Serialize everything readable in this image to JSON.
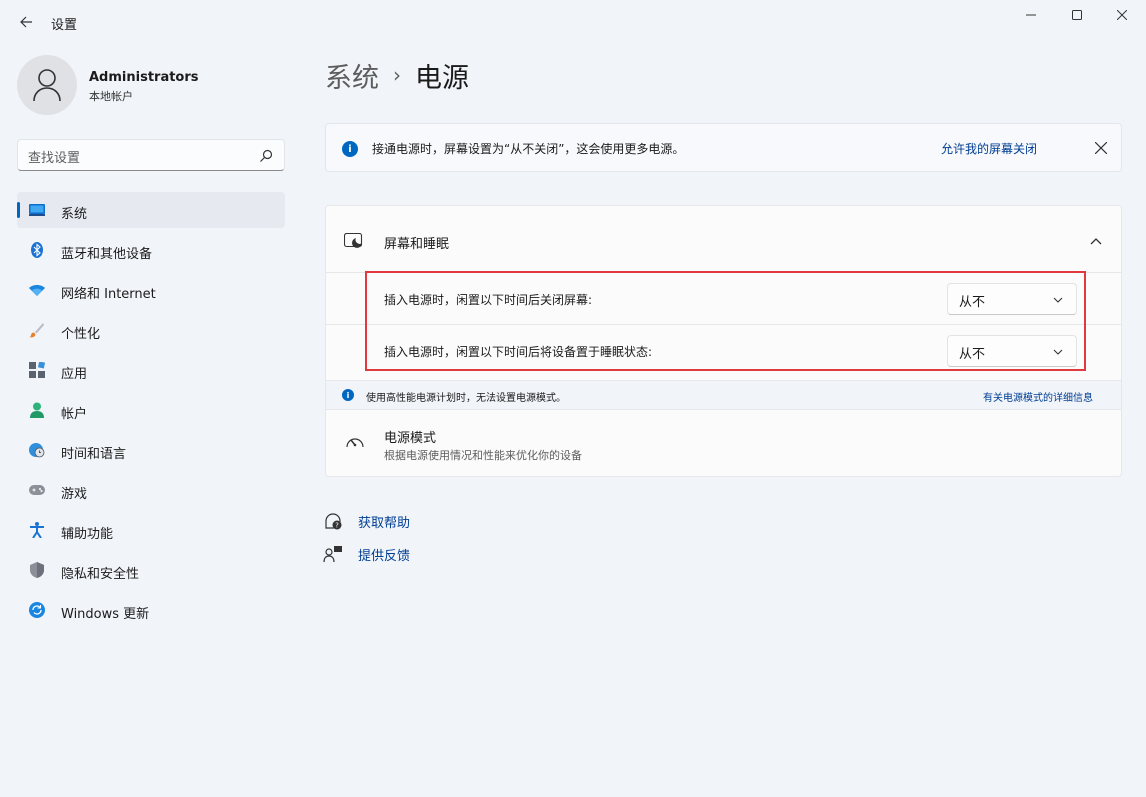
{
  "titlebar": {
    "app_title": "设置",
    "icons": {
      "back": "back-arrow-icon",
      "minimize": "minimize-icon",
      "maximize": "maximize-icon",
      "close": "close-icon"
    }
  },
  "profile": {
    "name": "Administrators",
    "account_type": "本地帐户"
  },
  "search": {
    "placeholder": "查找设置"
  },
  "sidebar": {
    "items": [
      {
        "label": "系统",
        "icon": "monitor-icon",
        "active": true
      },
      {
        "label": "蓝牙和其他设备",
        "icon": "bluetooth-icon"
      },
      {
        "label": "网络和 Internet",
        "icon": "wifi-icon"
      },
      {
        "label": "个性化",
        "icon": "brush-icon"
      },
      {
        "label": "应用",
        "icon": "apps-icon"
      },
      {
        "label": "帐户",
        "icon": "person-icon"
      },
      {
        "label": "时间和语言",
        "icon": "globe-clock-icon"
      },
      {
        "label": "游戏",
        "icon": "gamepad-icon"
      },
      {
        "label": "辅助功能",
        "icon": "accessibility-icon"
      },
      {
        "label": "隐私和安全性",
        "icon": "shield-icon"
      },
      {
        "label": "Windows 更新",
        "icon": "update-icon"
      }
    ]
  },
  "breadcrumb": {
    "parent": "系统",
    "separator": "›",
    "current": "电源"
  },
  "banner": {
    "icon": "info-icon",
    "text": "接通电源时，屏幕设置为“从不关闭”，这会使用更多电源。",
    "link": "允许我的屏幕关闭"
  },
  "screen_sleep": {
    "title": "屏幕和睡眠",
    "rows": [
      {
        "label": "插入电源时，闲置以下时间后关闭屏幕:",
        "value": "从不"
      },
      {
        "label": "插入电源时，闲置以下时间后将设备置于睡眠状态:",
        "value": "从不"
      }
    ]
  },
  "power_note": {
    "text": "使用高性能电源计划时，无法设置电源模式。",
    "link": "有关电源模式的详细信息"
  },
  "power_mode": {
    "title": "电源模式",
    "description": "根据电源使用情况和性能来优化你的设备"
  },
  "help": {
    "get_help": "获取帮助",
    "feedback": "提供反馈"
  },
  "colors": {
    "accent": "#0067c0",
    "highlight_border": "#e0393e",
    "link": "#003e92"
  }
}
